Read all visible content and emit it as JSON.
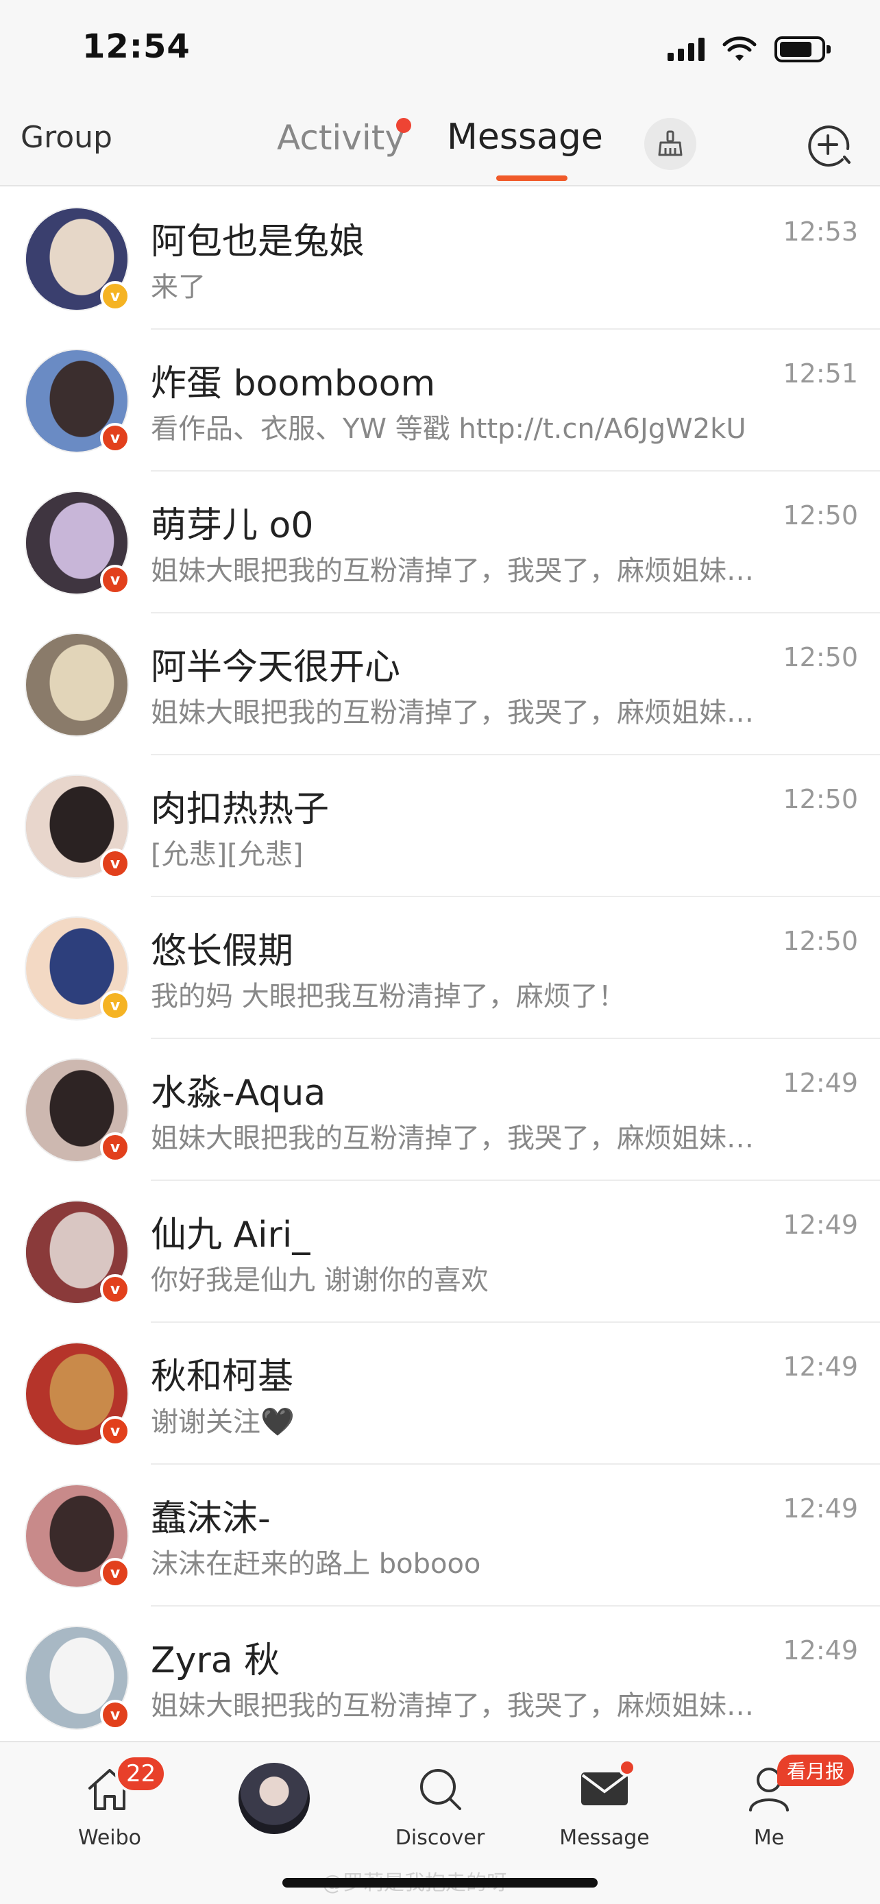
{
  "status_bar": {
    "time": "12:54"
  },
  "header": {
    "group_label": "Group",
    "activity_label": "Activity",
    "message_label": "Message",
    "broom_icon": "broom-icon",
    "compose_icon": "plus-circle-icon"
  },
  "conversations": [
    {
      "name": "阿包也是兔娘",
      "preview": "来了",
      "time": "12:53",
      "badge": "gold",
      "avatar_colors": [
        "#6a78b8",
        "#e6d7c8",
        "#3a3f6e"
      ]
    },
    {
      "name": "炸蛋 boomboom",
      "preview": "看作品、衣服、YW 等戳 http://t.cn/A6JgW2kU",
      "time": "12:51",
      "badge": "red",
      "avatar_colors": [
        "#d9c8c0",
        "#3b2e2e",
        "#6a8bc4"
      ]
    },
    {
      "name": "萌芽儿 o0",
      "preview": "姐妹大眼把我的互粉清掉了，我哭了，麻烦姐妹…",
      "time": "12:50",
      "badge": "red",
      "avatar_colors": [
        "#7a6a72",
        "#c8b6d8",
        "#3f3540"
      ]
    },
    {
      "name": "阿半今天很开心",
      "preview": "姐妹大眼把我的互粉清掉了，我哭了，麻烦姐妹…",
      "time": "12:50",
      "badge": "none",
      "avatar_colors": [
        "#f3ecd8",
        "#e2d5b9",
        "#8a7b6a"
      ]
    },
    {
      "name": "肉扣热热子",
      "preview": "[允悲][允悲]",
      "time": "12:50",
      "badge": "red",
      "avatar_colors": [
        "#c7b1a8",
        "#2a2222",
        "#e8d6cc"
      ]
    },
    {
      "name": "悠长假期",
      "preview": "我的妈 大眼把我互粉清掉了，麻烦了！",
      "time": "12:50",
      "badge": "gold",
      "avatar_colors": [
        "#f4f6fb",
        "#2d3f7c",
        "#f3d9c4"
      ]
    },
    {
      "name": "水淼-Aqua",
      "preview": "姐妹大眼把我的互粉清掉了，我哭了，麻烦姐妹…",
      "time": "12:49",
      "badge": "red",
      "avatar_colors": [
        "#e9dede",
        "#2e2424",
        "#cdb8b0"
      ]
    },
    {
      "name": "仙九 Airi_",
      "preview": "你好我是仙九 谢谢你的喜欢",
      "time": "12:49",
      "badge": "red",
      "avatar_colors": [
        "#3a2c30",
        "#d9c6c2",
        "#8a3a3a"
      ]
    },
    {
      "name": "秋和柯基",
      "preview": "谢谢关注🖤",
      "time": "12:49",
      "badge": "red",
      "avatar_colors": [
        "#e6d2b8",
        "#c98a4a",
        "#b5342a"
      ]
    },
    {
      "name": "蠢沫沫-",
      "preview": "沫沫在赶来的路上 bobooo",
      "time": "12:49",
      "badge": "red",
      "avatar_colors": [
        "#f0e0dc",
        "#3a2a2a",
        "#c88a8a"
      ]
    },
    {
      "name": "Zyra 秋",
      "preview": "姐妹大眼把我的互粉清掉了，我哭了，麻烦姐妹…",
      "time": "12:49",
      "badge": "red",
      "avatar_colors": [
        "#e6eef2",
        "#f4f4f4",
        "#a8b8c4"
      ]
    }
  ],
  "tabbar": {
    "weibo_label": "Weibo",
    "weibo_count": "22",
    "discover_label": "Discover",
    "message_label": "Message",
    "me_label": "Me",
    "me_badge": "看月报"
  },
  "watermark": "@罗莉是我抱走的呀"
}
